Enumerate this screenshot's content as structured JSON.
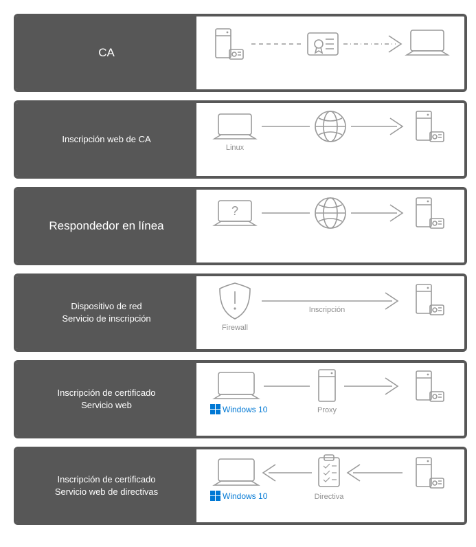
{
  "rows": [
    {
      "title1": "CA",
      "title2": "",
      "big": true
    },
    {
      "title1": "Inscripción web de CA",
      "title2": "",
      "big": false,
      "sub1": "Linux"
    },
    {
      "title1": "Respondedor en línea",
      "title2": "",
      "big": true
    },
    {
      "title1": "Dispositivo de red",
      "title2": "Servicio de inscripción",
      "big": false,
      "sub1": "Firewall",
      "sub2": "Inscripción"
    },
    {
      "title1": "Inscripción de certificado",
      "title2": "Servicio web",
      "big": false,
      "sub1": "Windows 10",
      "sub2": "Proxy"
    },
    {
      "title1": "Inscripción de certificado",
      "title2": "Servicio web de directivas",
      "big": false,
      "sub1": "Windows 10",
      "sub2": "Directiva"
    }
  ],
  "colors": {
    "panel": "#575757",
    "icon": "#9a9a9a",
    "accent": "#0078d4"
  }
}
